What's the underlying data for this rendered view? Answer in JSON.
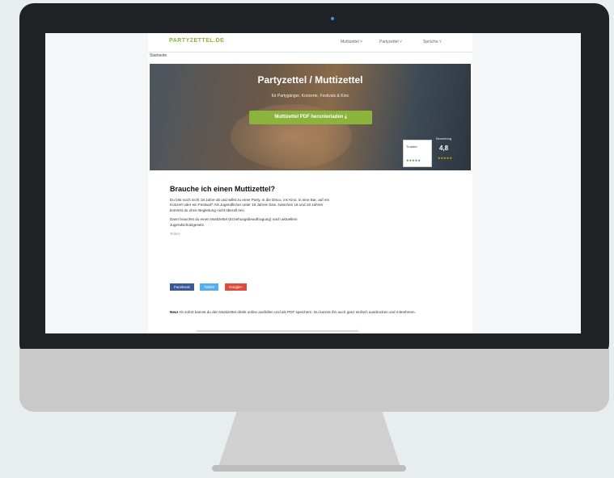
{
  "site": {
    "logo": "PARTYZETTEL.DE",
    "nav": [
      "Muttizettel ˅",
      "Partyzettel ˅",
      "Sprüche ˅"
    ],
    "breadcrumb": "Startseite"
  },
  "hero": {
    "title": "Partyzettel / Muttizettel",
    "subtitle": "für Partygänger, Konzerte, Festivals & Kino",
    "button_label": "Muttizettel PDF herunterladen ⤓",
    "badge_label": "Trusted",
    "badge_stars": "★★★★★",
    "rating_label": "Bewertung",
    "rating_score": "4,8",
    "rating_stars": "★★★★★"
  },
  "article": {
    "heading": "Brauche ich einen Muttizettel?",
    "paragraph1": "Du bist noch nicht 18 Jahre alt und willst zu einer Party, in die Disco, ins Kino, in eine Bar, auf ein Konzert oder ein Festival? Als Jugendlicher unter 16 Jahren bzw. zwischen 16 und 18 Jahren kommst du ohne Begleitung nicht überall rein.",
    "paragraph2": "Dann brauchst du einen Muttizettel (Erziehungsbeauftragung) nach aktuellem Jugendschutzgesetz.",
    "share_label": "Teilen:",
    "share_buttons": [
      "Facebook",
      "Twitter",
      "Google+"
    ],
    "note_bold": "Neu!",
    "note_text": "Ab sofort kannst du den Muttizettel direkt online ausfüllen und als PDF speichern. Du kannst ihn auch ganz einfach ausdrucken und mitnehmen."
  }
}
